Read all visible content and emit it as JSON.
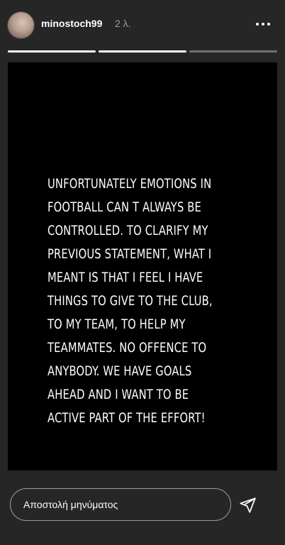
{
  "header": {
    "username": "minostoch99",
    "time": "2 λ.",
    "avatar_icon": "profile-avatar",
    "more_icon": "more-horizontal-icon"
  },
  "progress": {
    "segments": [
      1,
      1,
      0
    ]
  },
  "story": {
    "text": "UNFORTUNATELY EMOTIONS IN\nFOOTBALL CAN T ALWAYS BE\nCONTROLLED. TO CLARIFY MY\nPREVIOUS STATEMENT, WHAT I\nMEANT IS THAT I FEEL I HAVE\nTHINGS TO GIVE TO THE CLUB,\nTO MY TEAM, TO HELP MY\nTEAMMATES. NO OFFENCE TO\nANYBODY. WE HAVE GOALS\nAHEAD AND I WANT TO BE\nACTIVE PART OF THE EFFORT!",
    "background": "#000000",
    "text_color": "#ffffff"
  },
  "footer": {
    "message_placeholder": "Αποστολή μηνύματος",
    "message_value": "",
    "send_icon": "send-icon"
  },
  "colors": {
    "app_background": "#262626",
    "muted_text": "#9a9a9a"
  }
}
